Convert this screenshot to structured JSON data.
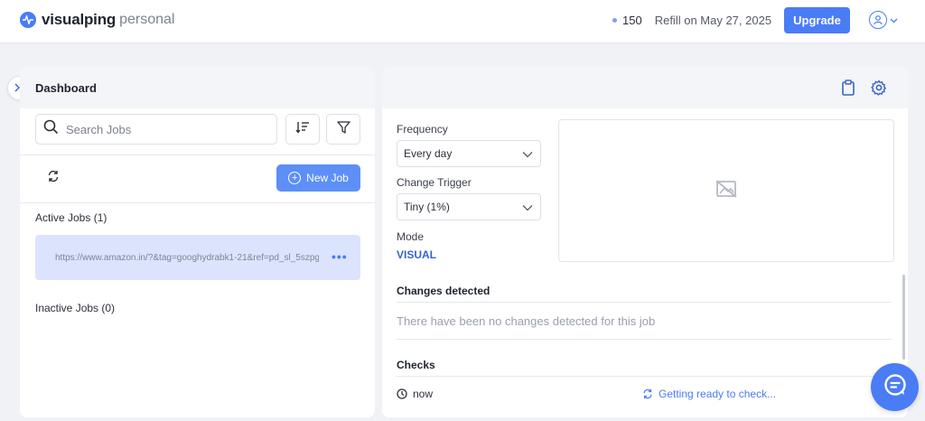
{
  "header": {
    "brand": "visualping",
    "plan": "personal",
    "credits": "150",
    "refill": "Refill on May 27, 2025",
    "upgrade_label": "Upgrade"
  },
  "left_panel": {
    "title": "Dashboard",
    "search_placeholder": "Search Jobs",
    "new_job_label": "New Job",
    "active_jobs_label": "Active Jobs (1)",
    "inactive_jobs_label": "Inactive Jobs (0)",
    "jobs": [
      {
        "url": "https://www.amazon.in/?&tag=googhydrabk1-21&ref=pd_sl_5szpg..."
      }
    ]
  },
  "right_panel": {
    "frequency_label": "Frequency",
    "frequency_value": "Every day",
    "trigger_label": "Change Trigger",
    "trigger_value": "Tiny (1%)",
    "mode_label": "Mode",
    "mode_value": "VISUAL",
    "changes_title": "Changes detected",
    "changes_empty": "There have been no changes detected for this job",
    "checks_title": "Checks",
    "check_time": "now",
    "check_status": "Getting ready to check..."
  },
  "colors": {
    "accent": "#4a7cf6",
    "job_highlight": "#dbe4fc",
    "panel_header": "#f4f5f8"
  },
  "icons": [
    "pulse-logo-icon",
    "chevron-down-icon",
    "user-icon",
    "double-chevron-right-icon",
    "search-icon",
    "sort-icon",
    "filter-icon",
    "refresh-icon",
    "plus-circle-icon",
    "more-icon",
    "clipboard-icon",
    "gear-icon",
    "image-off-icon",
    "clock-icon",
    "sync-icon",
    "chat-icon"
  ]
}
